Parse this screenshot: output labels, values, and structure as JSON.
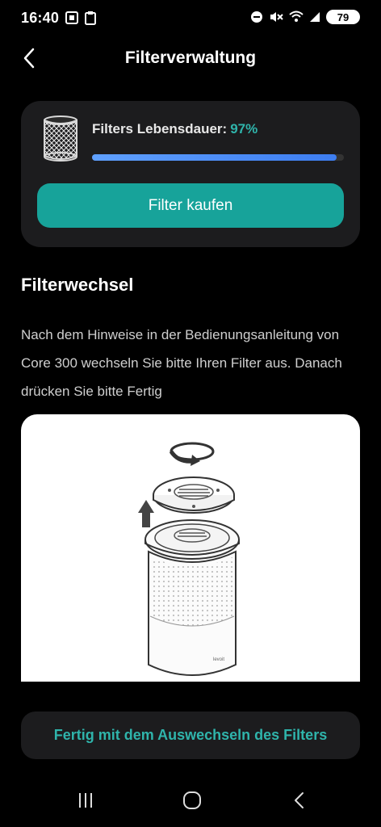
{
  "status_bar": {
    "time": "16:40",
    "battery": "79"
  },
  "header": {
    "title": "Filterverwaltung"
  },
  "filter_card": {
    "life_label": "Filters Lebensdauer:",
    "life_value": "97%",
    "life_fraction": 0.97,
    "buy_label": "Filter kaufen"
  },
  "section": {
    "title": "Filterwechsel",
    "instructions": "Nach dem Hinweise in der Bedienungsanleitung von Core 300 wechseln Sie bitte Ihren Filter aus. Danach drücken Sie bitte Fertig"
  },
  "illustration": {
    "device_label": "levoit"
  },
  "actions": {
    "done_label": "Fertig mit dem Auswechseln des Filters"
  },
  "colors": {
    "accent": "#17a39a",
    "accent_text": "#2fb4ab",
    "progress": "#4a8cf5",
    "card": "#1c1c1e"
  },
  "icons": {
    "back": "chevron-left-icon",
    "filter": "filter-cartridge-icon",
    "nav_recents": "recent-apps-icon",
    "nav_home": "home-icon",
    "nav_back": "back-icon"
  }
}
